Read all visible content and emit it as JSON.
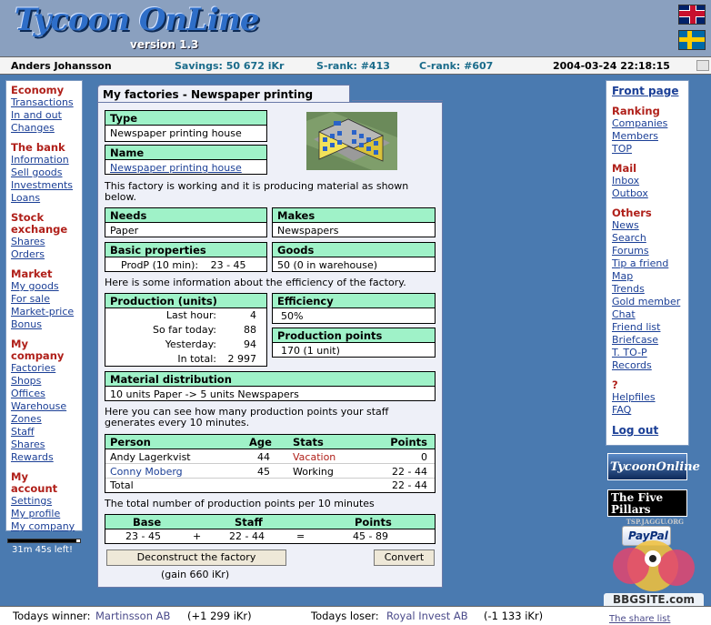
{
  "header": {
    "logo": "Tycoon OnLine",
    "version": "version 1.3",
    "flags": [
      "uk-flag-icon",
      "sweden-flag-icon"
    ]
  },
  "status": {
    "user": "Anders Johansson",
    "savings": "Savings: 50 672 iKr",
    "srank": "S-rank: #413",
    "crank": "C-rank: #607",
    "datetime": "2004-03-24 22:18:15"
  },
  "leftnav": {
    "sections": [
      {
        "title": "Economy",
        "items": [
          "Transactions",
          "In and out",
          "Changes"
        ]
      },
      {
        "title": "The bank",
        "items": [
          "Information",
          "Sell goods",
          "Investments",
          "Loans"
        ]
      },
      {
        "title": "Stock exchange",
        "items": [
          "Shares",
          "Orders"
        ]
      },
      {
        "title": "Market",
        "items": [
          "My goods",
          "For sale",
          "Market-price",
          "Bonus"
        ]
      },
      {
        "title": "My company",
        "items": [
          "Factories",
          "Shops",
          "Offices",
          "Warehouse",
          "Zones",
          "Staff",
          "Shares",
          "Rewards"
        ]
      },
      {
        "title": "My account",
        "items": [
          "Settings",
          "My profile",
          "My company"
        ]
      }
    ],
    "time_left": "31m 45s left!",
    "time_progress": 0.95
  },
  "rightnav": {
    "front": "Front page",
    "sections": [
      {
        "title": "Ranking",
        "items": [
          "Companies",
          "Members",
          "TOP"
        ]
      },
      {
        "title": "Mail",
        "items": [
          "Inbox",
          "Outbox"
        ]
      },
      {
        "title": "Others",
        "items": [
          "News",
          "Search",
          "Forums",
          "Tip a friend",
          "Map",
          "Trends",
          "Gold member",
          "Chat",
          "Friend list",
          "Briefcase",
          "T. TO-P",
          "Records"
        ]
      },
      {
        "title": "?",
        "items": [
          "Helpfiles",
          "FAQ"
        ]
      }
    ],
    "logout": "Log out",
    "banners": {
      "tycoon": "TycoonOnline",
      "pillars": "The Five Pillars",
      "pillars_url": "TSP.JAGGU.ORG",
      "paypal": "PayPal"
    }
  },
  "main": {
    "tab": "My factories - Newspaper printing house",
    "type_label": "Type",
    "type_value": "Newspaper printing house",
    "name_label": "Name",
    "name_value": "Newspaper printing house",
    "intro": "This factory is working and it is producing material as shown below.",
    "needs_label": "Needs",
    "needs_value": "Paper",
    "makes_label": "Makes",
    "makes_value": "Newspapers",
    "basic_label": "Basic properties",
    "basic_key": "ProdP (10 min):",
    "basic_value": "23 - 45",
    "goods_label": "Goods",
    "goods_value": "50 (0 in warehouse)",
    "efficiency_intro": "Here is some information about the efficiency of the factory.",
    "production_label": "Production (units)",
    "production": [
      {
        "k": "Last hour:",
        "v": "4"
      },
      {
        "k": "So far today:",
        "v": "88"
      },
      {
        "k": "Yesterday:",
        "v": "94"
      },
      {
        "k": "In total:",
        "v": "2 997"
      }
    ],
    "efficiency_label": "Efficiency",
    "efficiency_value": "50%",
    "points_label": "Production points",
    "points_value": "170 (1 unit)",
    "distribution_label": "Material distribution",
    "distribution_value": "10 units Paper -> 5 units Newspapers",
    "staff_intro": "Here you can see how many production points your staff generates every 10 minutes.",
    "staff_headers": {
      "person": "Person",
      "age": "Age",
      "stats": "Stats",
      "points": "Points"
    },
    "staff": [
      {
        "person": "Andy Lagerkvist",
        "age": "44",
        "stats": "Vacation",
        "points": "0"
      },
      {
        "person": "Conny Moberg",
        "age": "45",
        "stats": "Working",
        "points": "22 - 44"
      }
    ],
    "staff_total_label": "Total",
    "staff_total": "22 - 44",
    "total_intro": "The total number of production points per 10 minutes",
    "calc_headers": {
      "base": "Base",
      "staff": "Staff",
      "points": "Points"
    },
    "calc": {
      "base": "23 - 45",
      "plus": "+",
      "staff": "22 - 44",
      "eq": "=",
      "points": "45 - 89"
    },
    "deconstruct_button": "Deconstruct the factory",
    "gain": "(gain 660 iKr)",
    "convert_button": "Convert"
  },
  "footer": {
    "winner_label": "Todays winner:",
    "winner_name": "Martinsson AB",
    "winner_amount": "(+1 299 iKr)",
    "loser_label": "Todays loser:",
    "loser_name": "Royal Invest AB",
    "loser_amount": "(-1 133 iKr)",
    "share_list": "The share list"
  },
  "watermark": "BBGSITE.com",
  "colors": {
    "accent_green": "#9ff2c8",
    "nav_red": "#b0201a",
    "link_blue": "#1b3f96",
    "bg_blue": "#4a7ab0"
  }
}
